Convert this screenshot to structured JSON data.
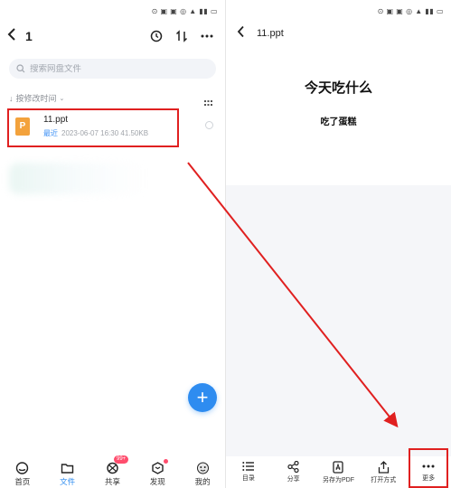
{
  "left": {
    "status_text": "⊙ ▣ ▣ ◎ ▲ ▮▮ ▭",
    "header": {
      "back_icon": "chevron-left-icon",
      "title": "1",
      "history_icon": "history-icon",
      "sort_icon": "sort-arrows-icon",
      "more_icon": "more-icon"
    },
    "search": {
      "placeholder": "搜索网盘文件"
    },
    "sort_label": "按修改时间",
    "file": {
      "name": "11.ppt",
      "recent_badge": "最近",
      "meta": "2023-06-07  16:30  41.50KB",
      "icon_letter": "P"
    },
    "fab_label": "+",
    "tabs": [
      {
        "label": "首页",
        "icon": "cloud-home-icon"
      },
      {
        "label": "文件",
        "icon": "folder-icon",
        "active": true
      },
      {
        "label": "共享",
        "icon": "share-network-icon",
        "badge": "99+"
      },
      {
        "label": "发现",
        "icon": "compass-icon",
        "dot": true
      },
      {
        "label": "我的",
        "icon": "avatar-icon"
      }
    ]
  },
  "right": {
    "status_text": "⊙ ▣ ▣ ◎ ▲ ▮▮ ▭",
    "title": "11.ppt",
    "slide": {
      "title": "今天吃什么",
      "subtitle": "吃了蛋糕"
    },
    "toolbar": [
      {
        "label": "目录",
        "icon": "list-icon"
      },
      {
        "label": "分享",
        "icon": "share-icon"
      },
      {
        "label": "另存为PDF",
        "icon": "pdf-icon"
      },
      {
        "label": "打开方式",
        "icon": "open-with-icon"
      },
      {
        "label": "更多",
        "icon": "more-icon"
      }
    ]
  },
  "colors": {
    "accent": "#2e8cf0",
    "highlight": "#e02020",
    "file_icon": "#f3a23c",
    "badge": "#ff4d6d"
  }
}
